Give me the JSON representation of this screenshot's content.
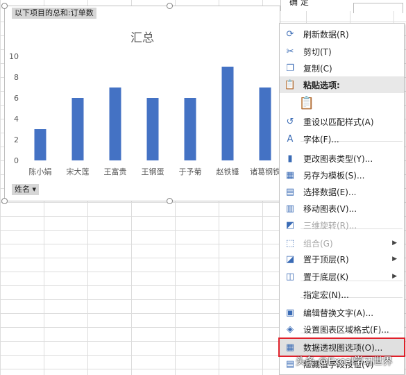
{
  "top_menu": {
    "label": "确    定"
  },
  "pivot": {
    "value_field": "以下项目的总和:订单数",
    "axis_field": "姓名"
  },
  "chart_data": {
    "type": "bar",
    "title": "汇总",
    "categories": [
      "陈小娟",
      "宋大莲",
      "王富贵",
      "王钢蛋",
      "于予菊",
      "赵铁锤",
      "诸葛钢铁"
    ],
    "values": [
      3,
      6,
      7,
      6,
      6,
      9,
      7
    ],
    "ylim": [
      0,
      10
    ],
    "yticks": [
      0,
      2,
      4,
      6,
      8,
      10
    ],
    "colors": {
      "bar": "#4472c4"
    },
    "grid": false
  },
  "context_menu": {
    "items": [
      {
        "label": "刷新数据(R)",
        "icon": "refresh-icon"
      },
      {
        "label": "剪切(T)",
        "icon": "scissors-icon"
      },
      {
        "label": "复制(C)",
        "icon": "copy-icon"
      },
      {
        "label": "粘贴选项:",
        "icon": "paste-icon"
      },
      {
        "label": "",
        "icon": "paste-option-icon"
      },
      {
        "label": "重设以匹配样式(A)",
        "icon": "reset-style-icon"
      },
      {
        "label": "字体(F)...",
        "icon": "font-icon"
      },
      {
        "label": "更改图表类型(Y)...",
        "icon": "chart-type-icon"
      },
      {
        "label": "另存为模板(S)...",
        "icon": "save-template-icon"
      },
      {
        "label": "选择数据(E)...",
        "icon": "select-data-icon"
      },
      {
        "label": "移动图表(V)...",
        "icon": "move-chart-icon"
      },
      {
        "label": "三维旋转(R)...",
        "icon": "rotate-3d-icon"
      },
      {
        "label": "组合(G)",
        "icon": "group-icon"
      },
      {
        "label": "置于顶层(R)",
        "icon": "bring-front-icon"
      },
      {
        "label": "置于底层(K)",
        "icon": "send-back-icon"
      },
      {
        "label": "指定宏(N)...",
        "icon": ""
      },
      {
        "label": "编辑替换文字(A)...",
        "icon": "alt-text-icon"
      },
      {
        "label": "设置图表区域格式(F)...",
        "icon": "format-area-icon"
      },
      {
        "label": "数据透视图选项(O)...",
        "icon": "pivot-options-icon"
      },
      {
        "label": "隐藏值字段按钮(V)",
        "icon": "field-buttons-icon"
      }
    ]
  },
  "watermark": "头条 @Excel学习世界"
}
